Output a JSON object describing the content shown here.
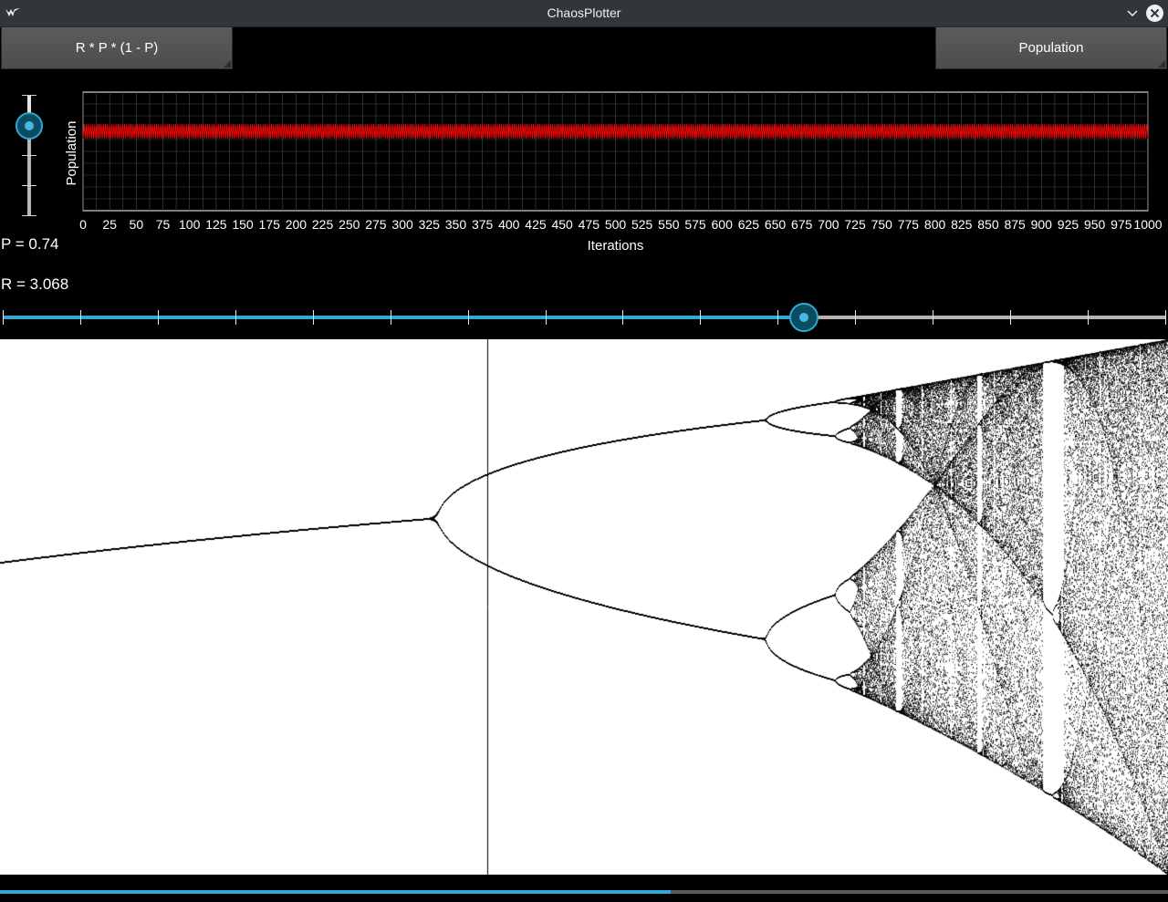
{
  "window": {
    "title": "ChaosPlotter",
    "icon": "app-logo-icon",
    "minimize_icon": "chevron-down-icon",
    "close_icon": "close-icon"
  },
  "toolbar": {
    "formula_label": "R * P * (1 - P)",
    "mode_label": "Population"
  },
  "controls": {
    "p_text": "P = 0.74",
    "r_text": "R = 3.068",
    "p_slider_level": 0.74,
    "r_slider_level": 0.689
  },
  "chart_data": [
    {
      "type": "line",
      "xlabel": "Iterations",
      "ylabel": "Population",
      "x_ticks": [
        "0",
        "25",
        "50",
        "75",
        "100",
        "125",
        "150",
        "175",
        "200",
        "225",
        "250",
        "275",
        "300",
        "325",
        "350",
        "375",
        "400",
        "425",
        "450",
        "475",
        "500",
        "525",
        "550",
        "575",
        "600",
        "625",
        "650",
        "675",
        "700",
        "725",
        "750",
        "775",
        "800",
        "825",
        "850",
        "875",
        "900",
        "925",
        "950",
        "975",
        "1000"
      ],
      "xlim": [
        0,
        1000
      ],
      "ylim": [
        0,
        1
      ],
      "grid": true,
      "series": [
        {
          "oscillation_values": [
            0.61,
            0.73
          ],
          "iterations": 1000,
          "color": "#ff0000"
        }
      ]
    },
    {
      "type": "scatter",
      "description_type": "bifurcation",
      "xlim": [
        2.4,
        4.0
      ],
      "ylim": [
        0,
        1
      ],
      "selected_r": 3.068,
      "color": "#000000"
    }
  ],
  "status": {
    "progress": 0.574
  },
  "colors": {
    "accent": "#2fa8d8",
    "series": "#ff0000",
    "background": "#000000"
  }
}
